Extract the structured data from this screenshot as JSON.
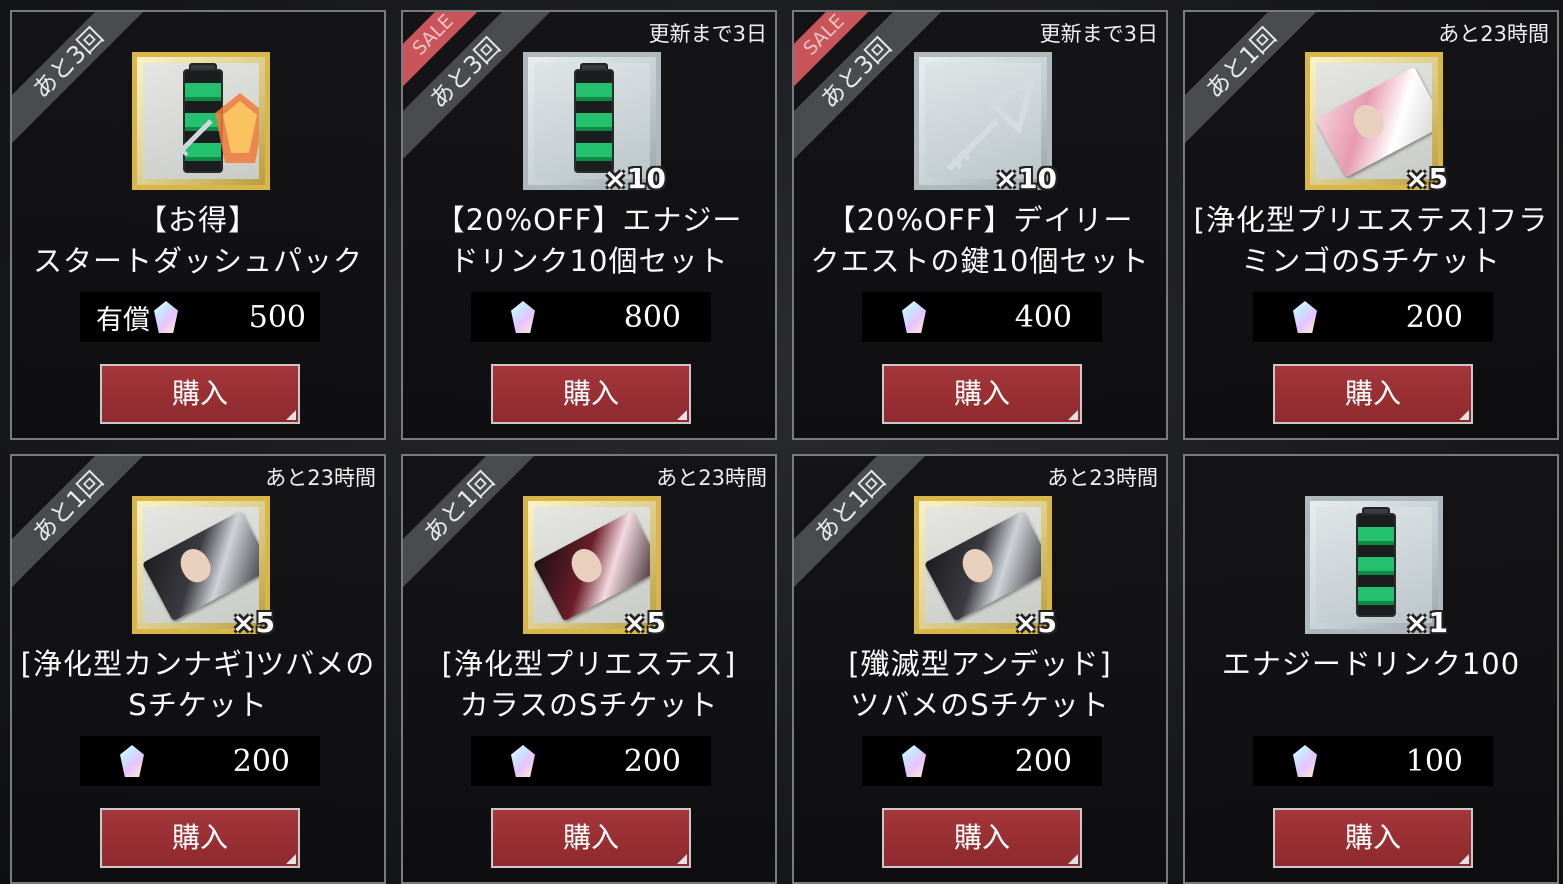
{
  "products": [
    {
      "ribbon": "あと3回",
      "sale": false,
      "timer": "",
      "name": "【お得】\nスタートダッシュパック",
      "paid_label": "有償",
      "price": "500",
      "qty": "",
      "frame": "gold",
      "icon": "starter-pack-icon",
      "buy_label": "購入"
    },
    {
      "ribbon": "あと3回",
      "sale": true,
      "sale_label": "SALE",
      "timer": "更新まで3日",
      "name": "【20%OFF】エナジー\nドリンク10個セット",
      "paid_label": "",
      "price": "800",
      "qty": "×10",
      "frame": "silver",
      "icon": "energy-drink-icon",
      "buy_label": "購入"
    },
    {
      "ribbon": "あと3回",
      "sale": true,
      "sale_label": "SALE",
      "timer": "更新まで3日",
      "name": "【20%OFF】デイリー\nクエストの鍵10個セット",
      "paid_label": "",
      "price": "400",
      "qty": "×10",
      "frame": "silver",
      "icon": "key-icon",
      "buy_label": "購入"
    },
    {
      "ribbon": "あと1回",
      "sale": false,
      "timer": "あと23時間",
      "name": "[浄化型プリエステス]フラ\nミンゴのSチケット",
      "paid_label": "",
      "price": "200",
      "qty": "×5",
      "frame": "gold",
      "icon": "ticket-pink-icon",
      "buy_label": "購入"
    },
    {
      "ribbon": "あと1回",
      "sale": false,
      "timer": "あと23時間",
      "name": "[浄化型カンナギ]ツバメの\nSチケット",
      "paid_label": "",
      "price": "200",
      "qty": "×5",
      "frame": "gold",
      "icon": "ticket-dark-icon",
      "buy_label": "購入"
    },
    {
      "ribbon": "あと1回",
      "sale": false,
      "timer": "あと23時間",
      "name": "[浄化型プリエステス]\nカラスのSチケット",
      "paid_label": "",
      "price": "200",
      "qty": "×5",
      "frame": "gold",
      "icon": "ticket-red-icon",
      "buy_label": "購入"
    },
    {
      "ribbon": "あと1回",
      "sale": false,
      "timer": "あと23時間",
      "name": "[殲滅型アンデッド]\nツバメのSチケット",
      "paid_label": "",
      "price": "200",
      "qty": "×5",
      "frame": "gold",
      "icon": "ticket-dark-icon",
      "buy_label": "購入"
    },
    {
      "ribbon": "",
      "sale": false,
      "timer": "",
      "name": "エナジードリンク100",
      "paid_label": "",
      "price": "100",
      "qty": "×1",
      "frame": "silver",
      "icon": "energy-drink-icon",
      "buy_label": "購入"
    }
  ],
  "colors": {
    "buy_button": "#9a3034",
    "ribbon": "#4a4b4f",
    "sale": "#c9545a",
    "gold_frame": "#d8b748",
    "silver_frame": "#aeb8bd"
  }
}
